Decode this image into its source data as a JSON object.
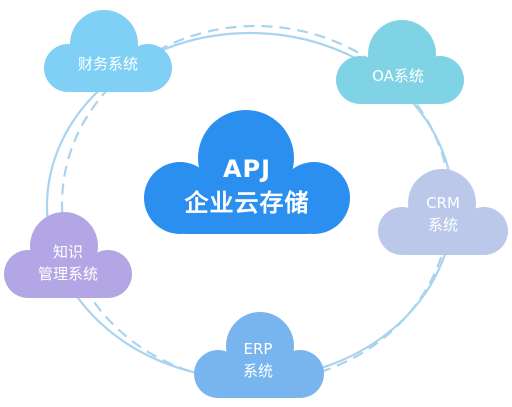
{
  "center": {
    "line1": "APJ",
    "line2": "企业云存储"
  },
  "nodes": {
    "finance": {
      "label": "财务系统"
    },
    "oa": {
      "label": "OA系统"
    },
    "crm": {
      "line1": "CRM",
      "line2": "系统"
    },
    "knowledge": {
      "line1": "知识",
      "line2": "管理系统"
    },
    "erp": {
      "line1": "ERP",
      "line2": "系统"
    }
  },
  "colors": {
    "center": "#2b8ff0",
    "finance": "#7fd0f4",
    "oa": "#7fd3e4",
    "crm": "#bcc8ea",
    "knowledge": "#b3a6e4",
    "erp": "#78b5ee",
    "ring": "#a8d4f0"
  }
}
